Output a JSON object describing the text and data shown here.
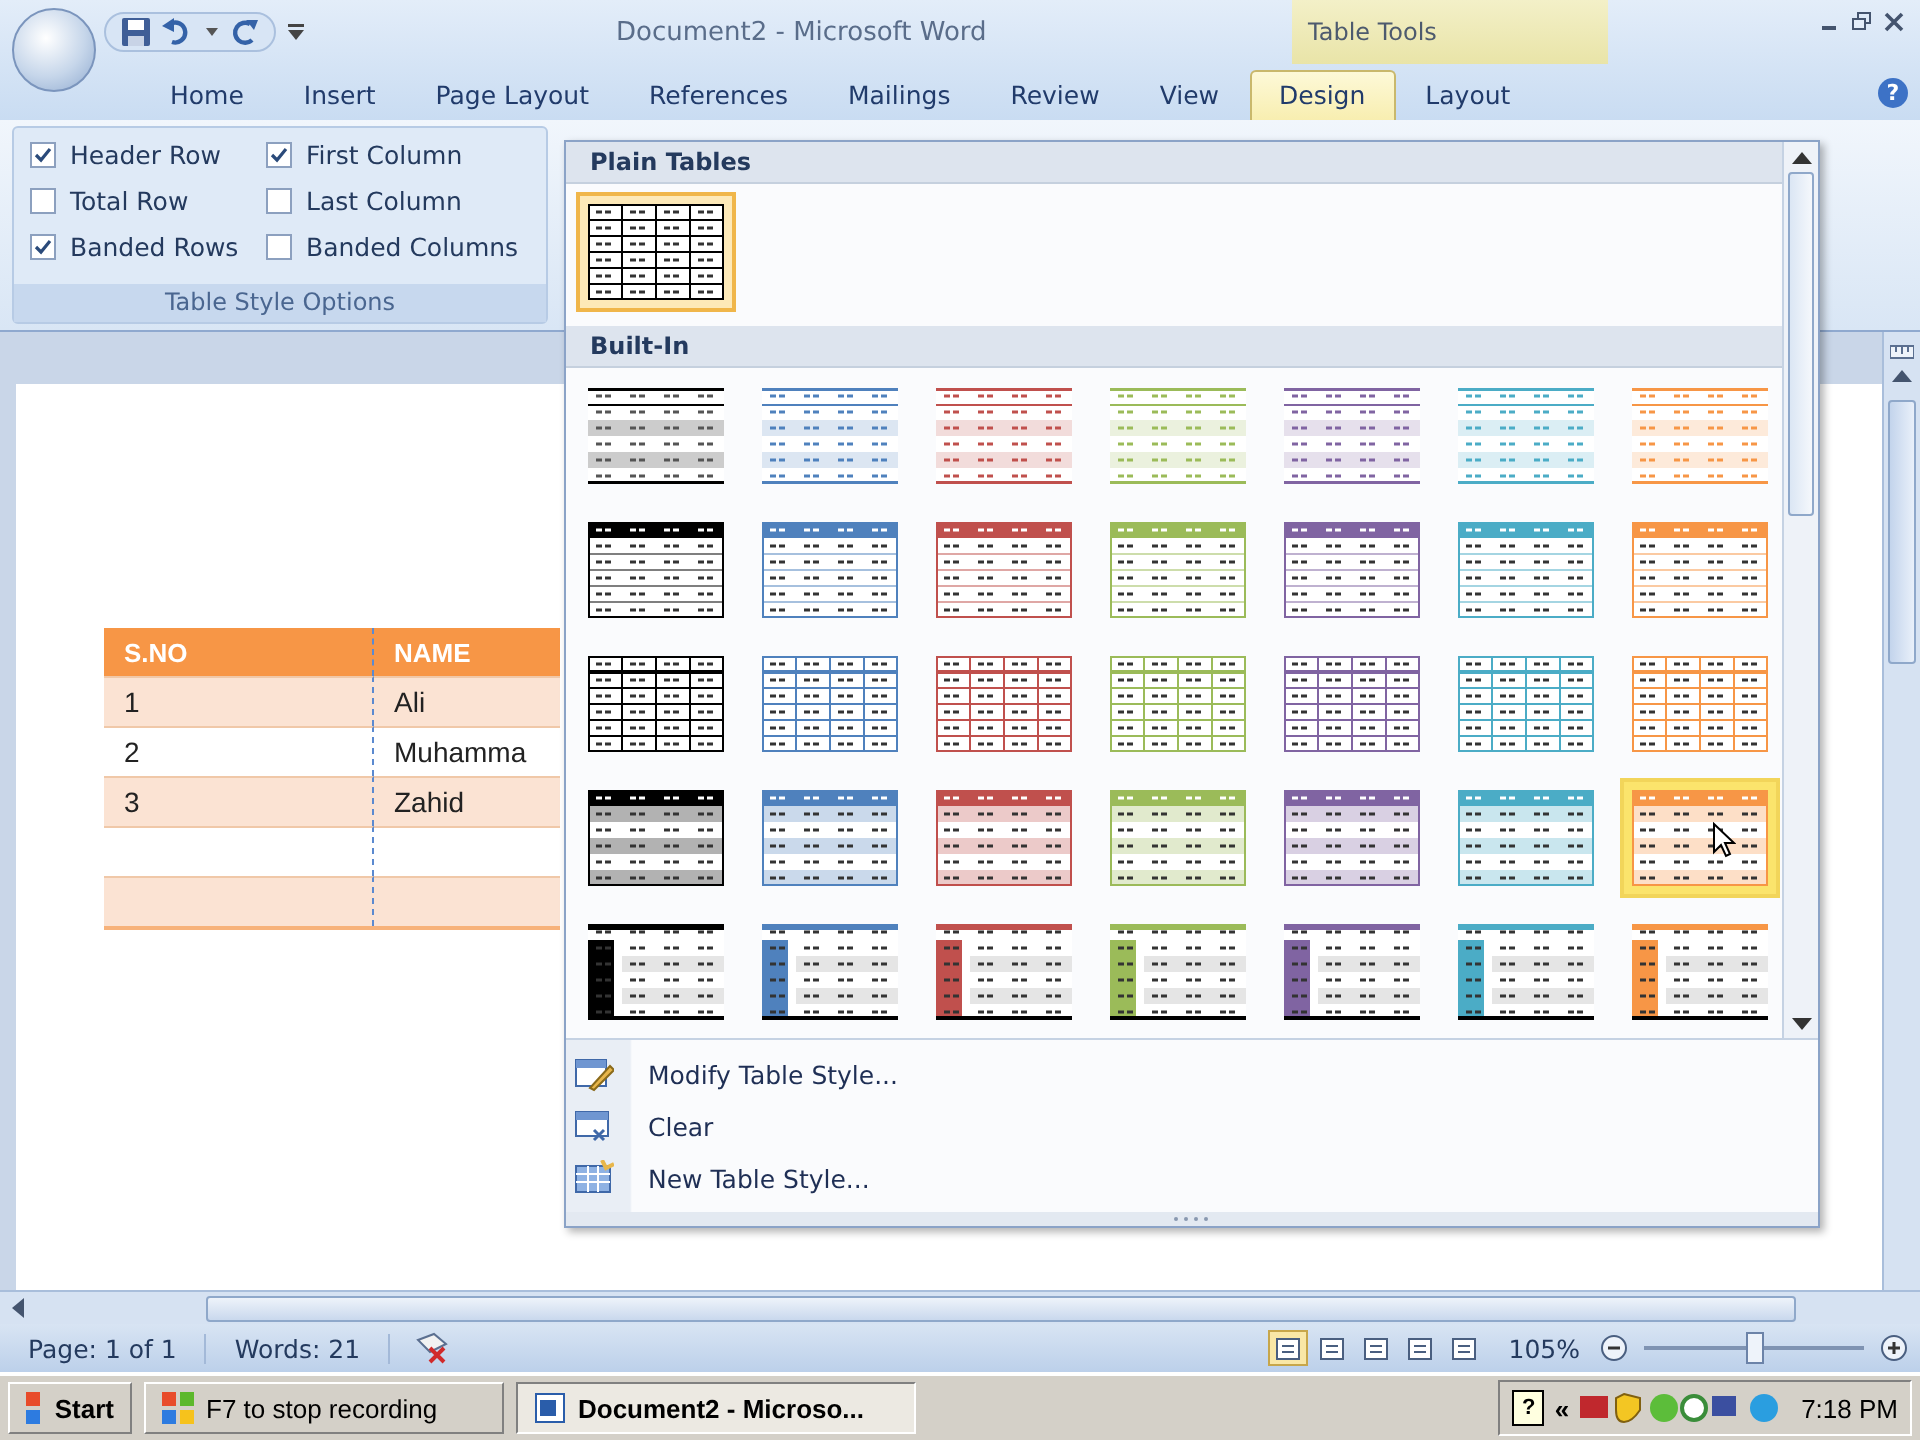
{
  "window": {
    "title": "Document2 - Microsoft Word",
    "context_label": "Table Tools"
  },
  "tabs": [
    {
      "label": "Home",
      "selected": false
    },
    {
      "label": "Insert",
      "selected": false
    },
    {
      "label": "Page Layout",
      "selected": false
    },
    {
      "label": "References",
      "selected": false
    },
    {
      "label": "Mailings",
      "selected": false
    },
    {
      "label": "Review",
      "selected": false
    },
    {
      "label": "View",
      "selected": false
    },
    {
      "label": "Design",
      "selected": true
    },
    {
      "label": "Layout",
      "selected": false
    }
  ],
  "help": "?",
  "ribbon_group": {
    "title": "Table Style Options",
    "options": [
      {
        "label": "Header Row",
        "checked": true
      },
      {
        "label": "First Column",
        "checked": true
      },
      {
        "label": "Total Row",
        "checked": false
      },
      {
        "label": "Last Column",
        "checked": false
      },
      {
        "label": "Banded Rows",
        "checked": true
      },
      {
        "label": "Banded Columns",
        "checked": false
      }
    ]
  },
  "document_table": {
    "columns": [
      "S.NO",
      "NAME"
    ],
    "rows": [
      {
        "cells": [
          "1",
          "Ali"
        ]
      },
      {
        "cells": [
          "2",
          "Muhamma"
        ]
      },
      {
        "cells": [
          "3",
          "Zahid"
        ]
      },
      {
        "blank": true
      },
      {
        "blank": true
      }
    ]
  },
  "gallery": {
    "sections": [
      {
        "title": "Plain Tables",
        "styles": [
          {
            "kind": "plain",
            "color": "#000000",
            "selected": true,
            "hovered": false
          }
        ]
      },
      {
        "title": "Built-In",
        "styles": [
          {
            "kind": "light-shading",
            "color": "#000000",
            "selected": false,
            "hovered": false
          },
          {
            "kind": "light-shading",
            "color": "#4f81bd",
            "selected": false,
            "hovered": false
          },
          {
            "kind": "light-shading",
            "color": "#c0504d",
            "selected": false,
            "hovered": false
          },
          {
            "kind": "light-shading",
            "color": "#9bbb59",
            "selected": false,
            "hovered": false
          },
          {
            "kind": "light-shading",
            "color": "#8064a2",
            "selected": false,
            "hovered": false
          },
          {
            "kind": "light-shading",
            "color": "#4bacc6",
            "selected": false,
            "hovered": false
          },
          {
            "kind": "light-shading",
            "color": "#f79646",
            "selected": false,
            "hovered": false
          },
          {
            "kind": "light-list",
            "color": "#000000",
            "selected": false,
            "hovered": false
          },
          {
            "kind": "light-list",
            "color": "#4f81bd",
            "selected": false,
            "hovered": false
          },
          {
            "kind": "light-list",
            "color": "#c0504d",
            "selected": false,
            "hovered": false
          },
          {
            "kind": "light-list",
            "color": "#9bbb59",
            "selected": false,
            "hovered": false
          },
          {
            "kind": "light-list",
            "color": "#8064a2",
            "selected": false,
            "hovered": false
          },
          {
            "kind": "light-list",
            "color": "#4bacc6",
            "selected": false,
            "hovered": false
          },
          {
            "kind": "light-list",
            "color": "#f79646",
            "selected": false,
            "hovered": false
          },
          {
            "kind": "light-grid",
            "color": "#000000",
            "selected": false,
            "hovered": false
          },
          {
            "kind": "light-grid",
            "color": "#4f81bd",
            "selected": false,
            "hovered": false
          },
          {
            "kind": "light-grid",
            "color": "#c0504d",
            "selected": false,
            "hovered": false
          },
          {
            "kind": "light-grid",
            "color": "#9bbb59",
            "selected": false,
            "hovered": false
          },
          {
            "kind": "light-grid",
            "color": "#8064a2",
            "selected": false,
            "hovered": false
          },
          {
            "kind": "light-grid",
            "color": "#4bacc6",
            "selected": false,
            "hovered": false
          },
          {
            "kind": "light-grid",
            "color": "#f79646",
            "selected": false,
            "hovered": false
          },
          {
            "kind": "medium-shading",
            "color": "#000000",
            "selected": false,
            "hovered": false
          },
          {
            "kind": "medium-shading",
            "color": "#4f81bd",
            "selected": false,
            "hovered": false
          },
          {
            "kind": "medium-shading",
            "color": "#c0504d",
            "selected": false,
            "hovered": false
          },
          {
            "kind": "medium-shading",
            "color": "#9bbb59",
            "selected": false,
            "hovered": false
          },
          {
            "kind": "medium-shading",
            "color": "#8064a2",
            "selected": false,
            "hovered": false
          },
          {
            "kind": "medium-shading",
            "color": "#4bacc6",
            "selected": false,
            "hovered": false
          },
          {
            "kind": "medium-shading",
            "color": "#f79646",
            "selected": false,
            "hovered": true
          },
          {
            "kind": "medium-list",
            "color": "#000000",
            "selected": false,
            "hovered": false
          },
          {
            "kind": "medium-list",
            "color": "#4f81bd",
            "selected": false,
            "hovered": false
          },
          {
            "kind": "medium-list",
            "color": "#c0504d",
            "selected": false,
            "hovered": false
          },
          {
            "kind": "medium-list",
            "color": "#9bbb59",
            "selected": false,
            "hovered": false
          },
          {
            "kind": "medium-list",
            "color": "#8064a2",
            "selected": false,
            "hovered": false
          },
          {
            "kind": "medium-list",
            "color": "#4bacc6",
            "selected": false,
            "hovered": false
          },
          {
            "kind": "medium-list",
            "color": "#f79646",
            "selected": false,
            "hovered": false
          }
        ]
      }
    ],
    "menu": [
      {
        "kind": "modify",
        "label": "Modify Table Style..."
      },
      {
        "kind": "clear",
        "label": "Clear"
      },
      {
        "kind": "new",
        "label": "New Table Style..."
      }
    ]
  },
  "status_bar": {
    "page": "Page: 1 of 1",
    "words": "Words: 21",
    "views": [
      {
        "selected": true
      },
      {
        "selected": false
      },
      {
        "selected": false
      },
      {
        "selected": false
      },
      {
        "selected": false
      }
    ],
    "zoom": "105%",
    "zoom_level": {
      "level": 0.5
    }
  },
  "taskbar": {
    "start": "Start",
    "buttons": [
      {
        "kind": "recorder",
        "label": "F7 to stop recording",
        "selected": false
      },
      {
        "kind": "word",
        "label": "Document2 - Microso...",
        "selected": true
      }
    ],
    "tray_help": "?",
    "tray_expand": "«",
    "time": "7:18 PM"
  }
}
